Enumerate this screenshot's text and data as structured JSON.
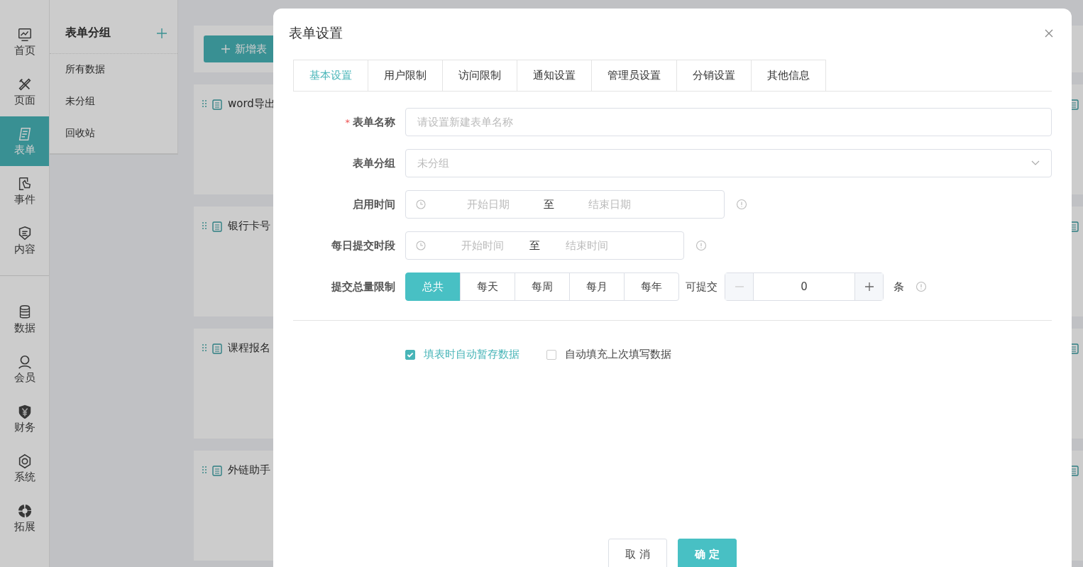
{
  "nav_top": [
    {
      "label": "首页",
      "kind": "monitor",
      "selected": false
    },
    {
      "label": "页面",
      "kind": "tools",
      "selected": false
    },
    {
      "label": "表单",
      "kind": "form",
      "selected": true
    },
    {
      "label": "事件",
      "kind": "touch",
      "selected": false
    },
    {
      "label": "内容",
      "kind": "shield",
      "selected": false
    }
  ],
  "nav_bottom": [
    {
      "label": "数据",
      "kind": "database",
      "selected": false
    },
    {
      "label": "会员",
      "kind": "user",
      "selected": false
    },
    {
      "label": "财务",
      "kind": "yen",
      "selected": false
    },
    {
      "label": "系统",
      "kind": "gear",
      "selected": false
    },
    {
      "label": "拓展",
      "kind": "ring",
      "selected": false
    }
  ],
  "groups": {
    "title": "表单分组",
    "items": [
      "所有数据",
      "未分组",
      "回收站"
    ]
  },
  "new_form_button": "新增表",
  "cards": [
    {
      "title": "word导出"
    },
    {
      "title": "银行卡号"
    },
    {
      "title": "课程报名"
    },
    {
      "title": "外链助手"
    }
  ],
  "modal": {
    "title": "表单设置",
    "tabs": [
      {
        "label": "基本设置",
        "selected": true
      },
      {
        "label": "用户限制",
        "selected": false
      },
      {
        "label": "访问限制",
        "selected": false
      },
      {
        "label": "通知设置",
        "selected": false
      },
      {
        "label": "管理员设置",
        "selected": false
      },
      {
        "label": "分销设置",
        "selected": false
      },
      {
        "label": "其他信息",
        "selected": false
      }
    ],
    "fields": [
      {
        "kind": "text",
        "label": "表单名称",
        "required_mark": "*",
        "placeholder": "请设置新建表单名称"
      },
      {
        "kind": "select",
        "label": "表单分组",
        "placeholder": "未分组"
      },
      {
        "kind": "date_range",
        "label": "启用时间",
        "start": "开始日期",
        "separator": "至",
        "end": "结束日期"
      },
      {
        "kind": "time_range",
        "label": "每日提交时段",
        "start": "开始时间",
        "separator": "至",
        "end": "结束时间"
      },
      {
        "kind": "limit",
        "label": "提交总量限制",
        "segments": [
          {
            "label": "总共",
            "selected": true
          },
          {
            "label": "每天",
            "selected": false
          },
          {
            "label": "每周",
            "selected": false
          },
          {
            "label": "每月",
            "selected": false
          },
          {
            "label": "每年",
            "selected": false
          }
        ],
        "allow_label": "可提交",
        "value": "0",
        "unit": "条"
      }
    ],
    "checkboxes": [
      {
        "label": "填表时自动暂存数据",
        "checked": true
      },
      {
        "label": "自动填充上次填写数据",
        "checked": false
      }
    ],
    "buttons": [
      {
        "label": "取 消",
        "kind": "cancel"
      },
      {
        "label": "确 定",
        "kind": "primary"
      }
    ]
  }
}
